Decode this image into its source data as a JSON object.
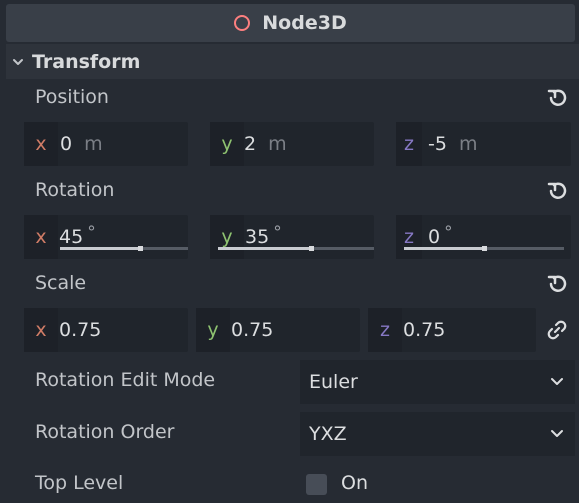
{
  "header": {
    "node_type": "Node3D",
    "icon": "circle-outline-icon",
    "icon_color": "#fc7f7f"
  },
  "section": {
    "title": "Transform"
  },
  "position": {
    "label": "Position",
    "x": {
      "axis": "x",
      "value": "0",
      "unit": "m"
    },
    "y": {
      "axis": "y",
      "value": "2",
      "unit": "m"
    },
    "z": {
      "axis": "z",
      "value": "-5",
      "unit": "m"
    }
  },
  "rotation": {
    "label": "Rotation",
    "x": {
      "axis": "x",
      "value": "45",
      "unit": "°",
      "slider_fraction": 0.625
    },
    "y": {
      "axis": "y",
      "value": "35",
      "unit": "°",
      "slider_fraction": 0.5972
    },
    "z": {
      "axis": "z",
      "value": "0",
      "unit": "°",
      "slider_fraction": 0.5
    }
  },
  "scale": {
    "label": "Scale",
    "x": {
      "axis": "x",
      "value": "0.75"
    },
    "y": {
      "axis": "y",
      "value": "0.75"
    },
    "z": {
      "axis": "z",
      "value": "0.75"
    },
    "link_icon": "link-icon"
  },
  "rotation_edit_mode": {
    "label": "Rotation Edit Mode",
    "value": "Euler"
  },
  "rotation_order": {
    "label": "Rotation Order",
    "value": "YXZ"
  },
  "top_level": {
    "label": "Top Level",
    "checkbox_label": "On",
    "checked": false
  },
  "colors": {
    "axis_x": "#d07c66",
    "axis_y": "#8ec270",
    "axis_z": "#8678c4",
    "background": "#262b33"
  }
}
